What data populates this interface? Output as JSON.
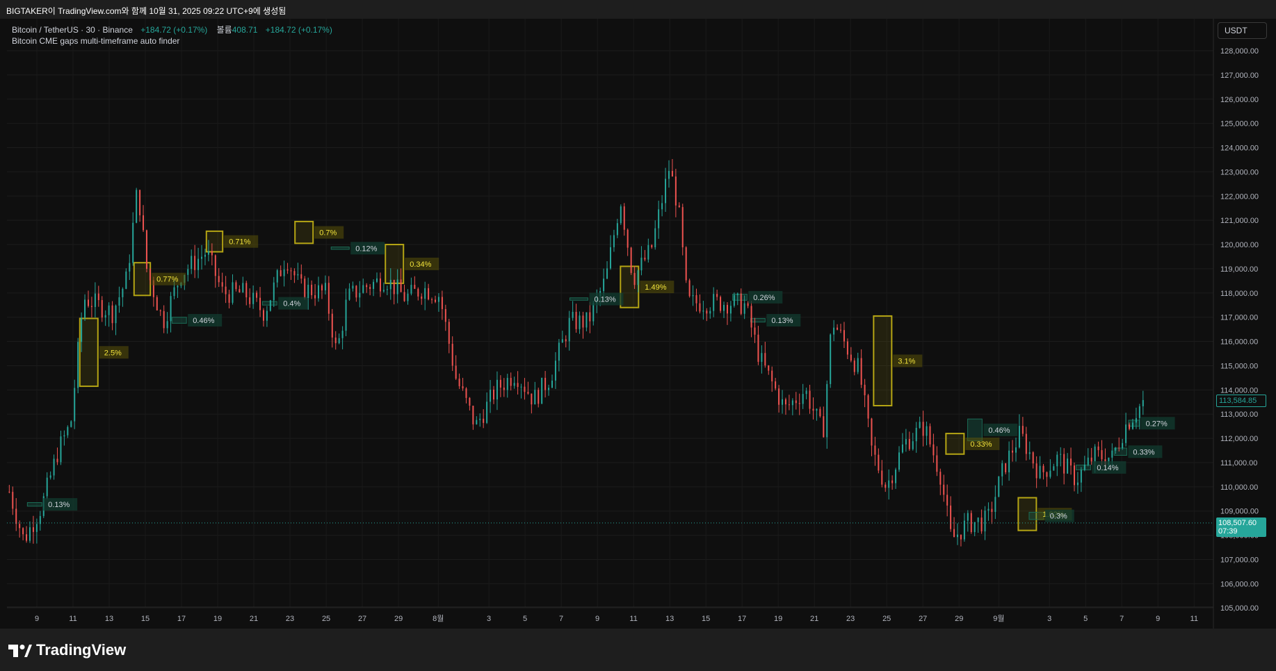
{
  "header": {
    "title": "BIGTAKER이 TradingView.com와 함께 10월 31, 2025 09:22 UTC+9에 생성됨"
  },
  "legend": {
    "symbol": "Bitcoin / TetherUS · 30 · Binance",
    "change": "+184.72 (+0.17%)",
    "volume_label": "볼륨",
    "volume_value": "408.71",
    "change2": "+184.72 (+0.17%)"
  },
  "indicator": {
    "name": "Bitcoin CME gaps multi-timeframe auto finder"
  },
  "currency_button": "USDT",
  "price_tags": {
    "upper": "113,584.85",
    "last": "108,507.60",
    "countdown": "07:39"
  },
  "colors": {
    "background": "#0f0f0f",
    "up": "#26a69a",
    "down": "#ef5350",
    "gap_yellow": "#b5a514",
    "gap_green": "#1b6b55",
    "last_price": "#26a69a"
  },
  "footer": {
    "brand": "TradingView"
  },
  "chart_data": {
    "type": "candlestick",
    "symbol": "BTCUSDT",
    "timeframe": "30",
    "ylim": [
      104500,
      128500
    ],
    "y_ticks": [
      "128,000.00",
      "127,000.00",
      "126,000.00",
      "125,000.00",
      "124,000.00",
      "123,000.00",
      "122,000.00",
      "121,000.00",
      "120,000.00",
      "119,000.00",
      "118,000.00",
      "117,000.00",
      "116,000.00",
      "115,000.00",
      "114,000.00",
      "113,000.00",
      "112,000.00",
      "111,000.00",
      "110,000.00",
      "109,000.00",
      "108,000.00",
      "107,000.00",
      "106,000.00",
      "105,000.00"
    ],
    "x_ticks": [
      "9",
      "11",
      "13",
      "15",
      "17",
      "19",
      "21",
      "23",
      "25",
      "27",
      "29",
      "8월",
      "3",
      "5",
      "7",
      "9",
      "11",
      "13",
      "15",
      "17",
      "19",
      "21",
      "23",
      "25",
      "27",
      "29",
      "9월",
      "3",
      "5",
      "7",
      "9",
      "11"
    ],
    "price_path": [
      {
        "day": 7.5,
        "price": 109800
      },
      {
        "day": 8.3,
        "price": 107800
      },
      {
        "day": 9.3,
        "price": 109200
      },
      {
        "day": 10.2,
        "price": 111500
      },
      {
        "day": 10.9,
        "price": 112600
      },
      {
        "day": 11.6,
        "price": 117800
      },
      {
        "day": 12.4,
        "price": 117500
      },
      {
        "day": 13.2,
        "price": 117200
      },
      {
        "day": 14.0,
        "price": 118600
      },
      {
        "day": 14.6,
        "price": 122400
      },
      {
        "day": 15.1,
        "price": 119000
      },
      {
        "day": 16.0,
        "price": 116800
      },
      {
        "day": 17.0,
        "price": 118800
      },
      {
        "day": 18.4,
        "price": 119700
      },
      {
        "day": 19.3,
        "price": 118000
      },
      {
        "day": 20.5,
        "price": 118000
      },
      {
        "day": 21.6,
        "price": 117200
      },
      {
        "day": 22.8,
        "price": 119500
      },
      {
        "day": 23.6,
        "price": 118200
      },
      {
        "day": 25.0,
        "price": 118000
      },
      {
        "day": 25.6,
        "price": 115500
      },
      {
        "day": 26.2,
        "price": 117800
      },
      {
        "day": 27.0,
        "price": 118200
      },
      {
        "day": 28.3,
        "price": 118600
      },
      {
        "day": 29.4,
        "price": 117800
      },
      {
        "day": 30.4,
        "price": 118200
      },
      {
        "day": 31.3,
        "price": 117900
      },
      {
        "day": 32.2,
        "price": 114500
      },
      {
        "day": 33.3,
        "price": 112500
      },
      {
        "day": 34.4,
        "price": 114000
      },
      {
        "day": 35.5,
        "price": 114700
      },
      {
        "day": 36.5,
        "price": 113600
      },
      {
        "day": 37.4,
        "price": 114500
      },
      {
        "day": 38.5,
        "price": 116800
      },
      {
        "day": 39.5,
        "price": 116800
      },
      {
        "day": 40.5,
        "price": 118600
      },
      {
        "day": 41.3,
        "price": 121900
      },
      {
        "day": 42.0,
        "price": 118600
      },
      {
        "day": 43.0,
        "price": 119800
      },
      {
        "day": 44.0,
        "price": 123200
      },
      {
        "day": 44.5,
        "price": 121500
      },
      {
        "day": 45.0,
        "price": 117600
      },
      {
        "day": 46.0,
        "price": 117600
      },
      {
        "day": 47.4,
        "price": 117600
      },
      {
        "day": 48.2,
        "price": 117500
      },
      {
        "day": 49.0,
        "price": 115300
      },
      {
        "day": 50.4,
        "price": 113200
      },
      {
        "day": 51.5,
        "price": 114000
      },
      {
        "day": 52.5,
        "price": 112200
      },
      {
        "day": 53.0,
        "price": 116900
      },
      {
        "day": 54.5,
        "price": 114800
      },
      {
        "day": 55.2,
        "price": 111500
      },
      {
        "day": 56.0,
        "price": 110000
      },
      {
        "day": 57.0,
        "price": 111800
      },
      {
        "day": 58.1,
        "price": 112500
      },
      {
        "day": 59.0,
        "price": 110500
      },
      {
        "day": 59.6,
        "price": 107800
      },
      {
        "day": 60.5,
        "price": 108500
      },
      {
        "day": 61.6,
        "price": 108600
      },
      {
        "day": 62.5,
        "price": 110800
      },
      {
        "day": 63.4,
        "price": 112200
      },
      {
        "day": 64.5,
        "price": 110500
      },
      {
        "day": 65.5,
        "price": 111200
      },
      {
        "day": 66.5,
        "price": 110300
      },
      {
        "day": 67.5,
        "price": 111300
      },
      {
        "day": 68.5,
        "price": 111200
      },
      {
        "day": 69.2,
        "price": 112500
      },
      {
        "day": 70.3,
        "price": 113600
      }
    ],
    "gaps": [
      {
        "type": "yellow",
        "day_start": 11.4,
        "day_end": 12.4,
        "top": 116950,
        "bottom": 114150,
        "label": "2.5%"
      },
      {
        "type": "yellow",
        "day_start": 14.4,
        "day_end": 15.3,
        "top": 119250,
        "bottom": 117900,
        "label": "0.77%"
      },
      {
        "type": "yellow",
        "day_start": 18.4,
        "day_end": 19.3,
        "top": 120550,
        "bottom": 119700,
        "label": "0.71%"
      },
      {
        "type": "yellow",
        "day_start": 23.3,
        "day_end": 24.3,
        "top": 120950,
        "bottom": 120050,
        "label": "0.7%"
      },
      {
        "type": "yellow",
        "day_start": 28.3,
        "day_end": 29.3,
        "top": 120000,
        "bottom": 118400,
        "label": "0.34%"
      },
      {
        "type": "yellow",
        "day_start": 41.3,
        "day_end": 42.3,
        "top": 119100,
        "bottom": 117400,
        "label": "1.49%"
      },
      {
        "type": "yellow",
        "day_start": 55.3,
        "day_end": 56.3,
        "top": 117050,
        "bottom": 113350,
        "label": "3.1%"
      },
      {
        "type": "yellow",
        "day_start": 59.3,
        "day_end": 60.3,
        "top": 112200,
        "bottom": 111350,
        "label": "0.33%"
      },
      {
        "type": "yellow",
        "day_start": 63.3,
        "day_end": 64.3,
        "top": 109550,
        "bottom": 108200,
        "label": "1.02%"
      },
      {
        "type": "green",
        "day_start": 8.5,
        "day_end": 9.3,
        "top": 109350,
        "bottom": 109200,
        "label": "0.13%"
      },
      {
        "type": "green",
        "day_start": 16.5,
        "day_end": 17.3,
        "top": 117000,
        "bottom": 116750,
        "label": "0.46%"
      },
      {
        "type": "green",
        "day_start": 21.5,
        "day_end": 22.3,
        "top": 117650,
        "bottom": 117500,
        "label": "0.4%"
      },
      {
        "type": "green",
        "day_start": 25.3,
        "day_end": 26.3,
        "top": 119900,
        "bottom": 119800,
        "label": "0.12%"
      },
      {
        "type": "green",
        "day_start": 38.5,
        "day_end": 39.5,
        "top": 117800,
        "bottom": 117700,
        "label": "0.13%"
      },
      {
        "type": "green",
        "day_start": 47.5,
        "day_end": 48.3,
        "top": 117950,
        "bottom": 117700,
        "label": "0.26%"
      },
      {
        "type": "green",
        "day_start": 48.5,
        "day_end": 49.3,
        "top": 116950,
        "bottom": 116800,
        "label": "0.13%"
      },
      {
        "type": "green",
        "day_start": 60.5,
        "day_end": 61.3,
        "top": 112800,
        "bottom": 111900,
        "label": "0.46%"
      },
      {
        "type": "green",
        "day_start": 63.9,
        "day_end": 64.7,
        "top": 108950,
        "bottom": 108650,
        "label": "0.3%"
      },
      {
        "type": "green",
        "day_start": 66.5,
        "day_end": 67.3,
        "top": 110900,
        "bottom": 110700,
        "label": "0.14%"
      },
      {
        "type": "green",
        "day_start": 68.6,
        "day_end": 69.3,
        "top": 111600,
        "bottom": 111300,
        "label": "0.33%"
      },
      {
        "type": "green",
        "day_start": 69.4,
        "day_end": 70.0,
        "top": 112750,
        "bottom": 112500,
        "label": "0.27%"
      }
    ],
    "last_price": 108507.6,
    "upper_marker": 113584.85
  }
}
